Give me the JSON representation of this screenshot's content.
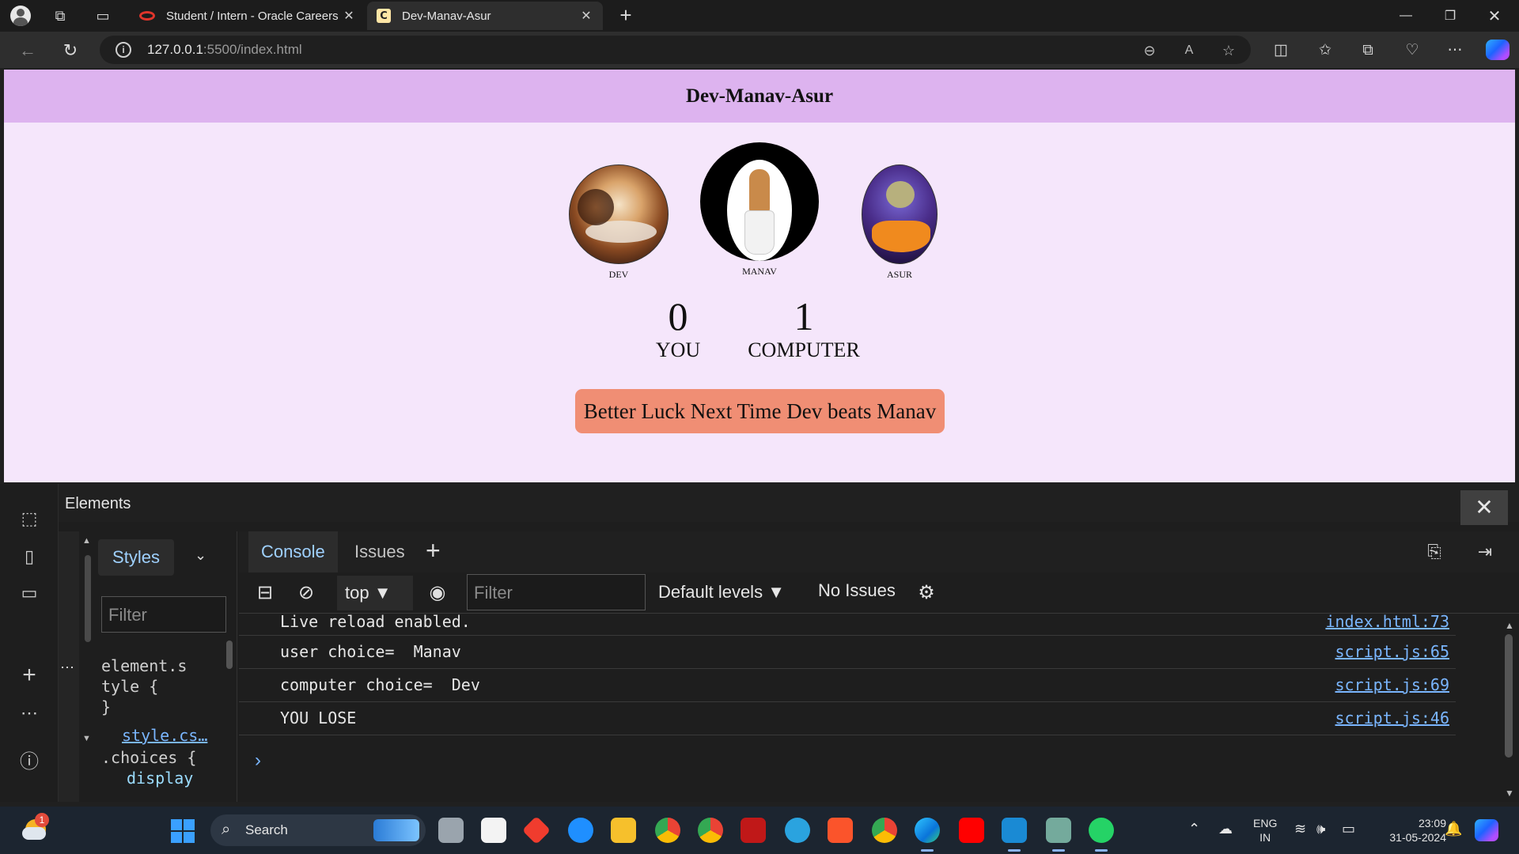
{
  "browser": {
    "tabs": [
      {
        "label": "Student / Intern - Oracle Careers",
        "active": false
      },
      {
        "label": "Dev-Manav-Asur",
        "active": true,
        "favicon_letter": "C"
      }
    ],
    "url_host": "127.0.0.1",
    "url_rest": ":5500/index.html"
  },
  "page": {
    "title": "Dev-Manav-Asur",
    "choices": [
      {
        "name": "DEV"
      },
      {
        "name": "MANAV"
      },
      {
        "name": "ASUR"
      }
    ],
    "user_score": "0",
    "user_label": "YOU",
    "comp_score": "1",
    "comp_label": "COMPUTER",
    "message": "Better Luck Next Time Dev beats Manav",
    "colors": {
      "header": "#ddb3ef",
      "background": "#f5e6fb",
      "message_bg": "#f08e74"
    }
  },
  "devtools": {
    "panel_title": "Elements",
    "styles_tab": "Styles",
    "styles_filter_placeholder": "Filter",
    "styles_code": {
      "line1": "element.s",
      "line2": "tyle {",
      "line3": "}",
      "link": "style.cs…",
      "selector": ".choices {",
      "prop": "display"
    },
    "console_tabs": [
      "Console",
      "Issues"
    ],
    "context": "top",
    "filter_placeholder": "Filter",
    "levels": "Default levels",
    "issues": "No Issues",
    "logs": [
      {
        "text": "Live reload enabled.",
        "source": "index.html:73"
      },
      {
        "text": "user choice=  Manav",
        "source": "script.js:65"
      },
      {
        "text": "computer choice=  Dev",
        "source": "script.js:69"
      },
      {
        "text": "YOU LOSE",
        "source": "script.js:46"
      }
    ]
  },
  "taskbar": {
    "weather_badge": "1",
    "search_label": "Search",
    "lang_top": "ENG",
    "lang_bottom": "IN",
    "time": "23:09",
    "date": "31-05-2024"
  }
}
